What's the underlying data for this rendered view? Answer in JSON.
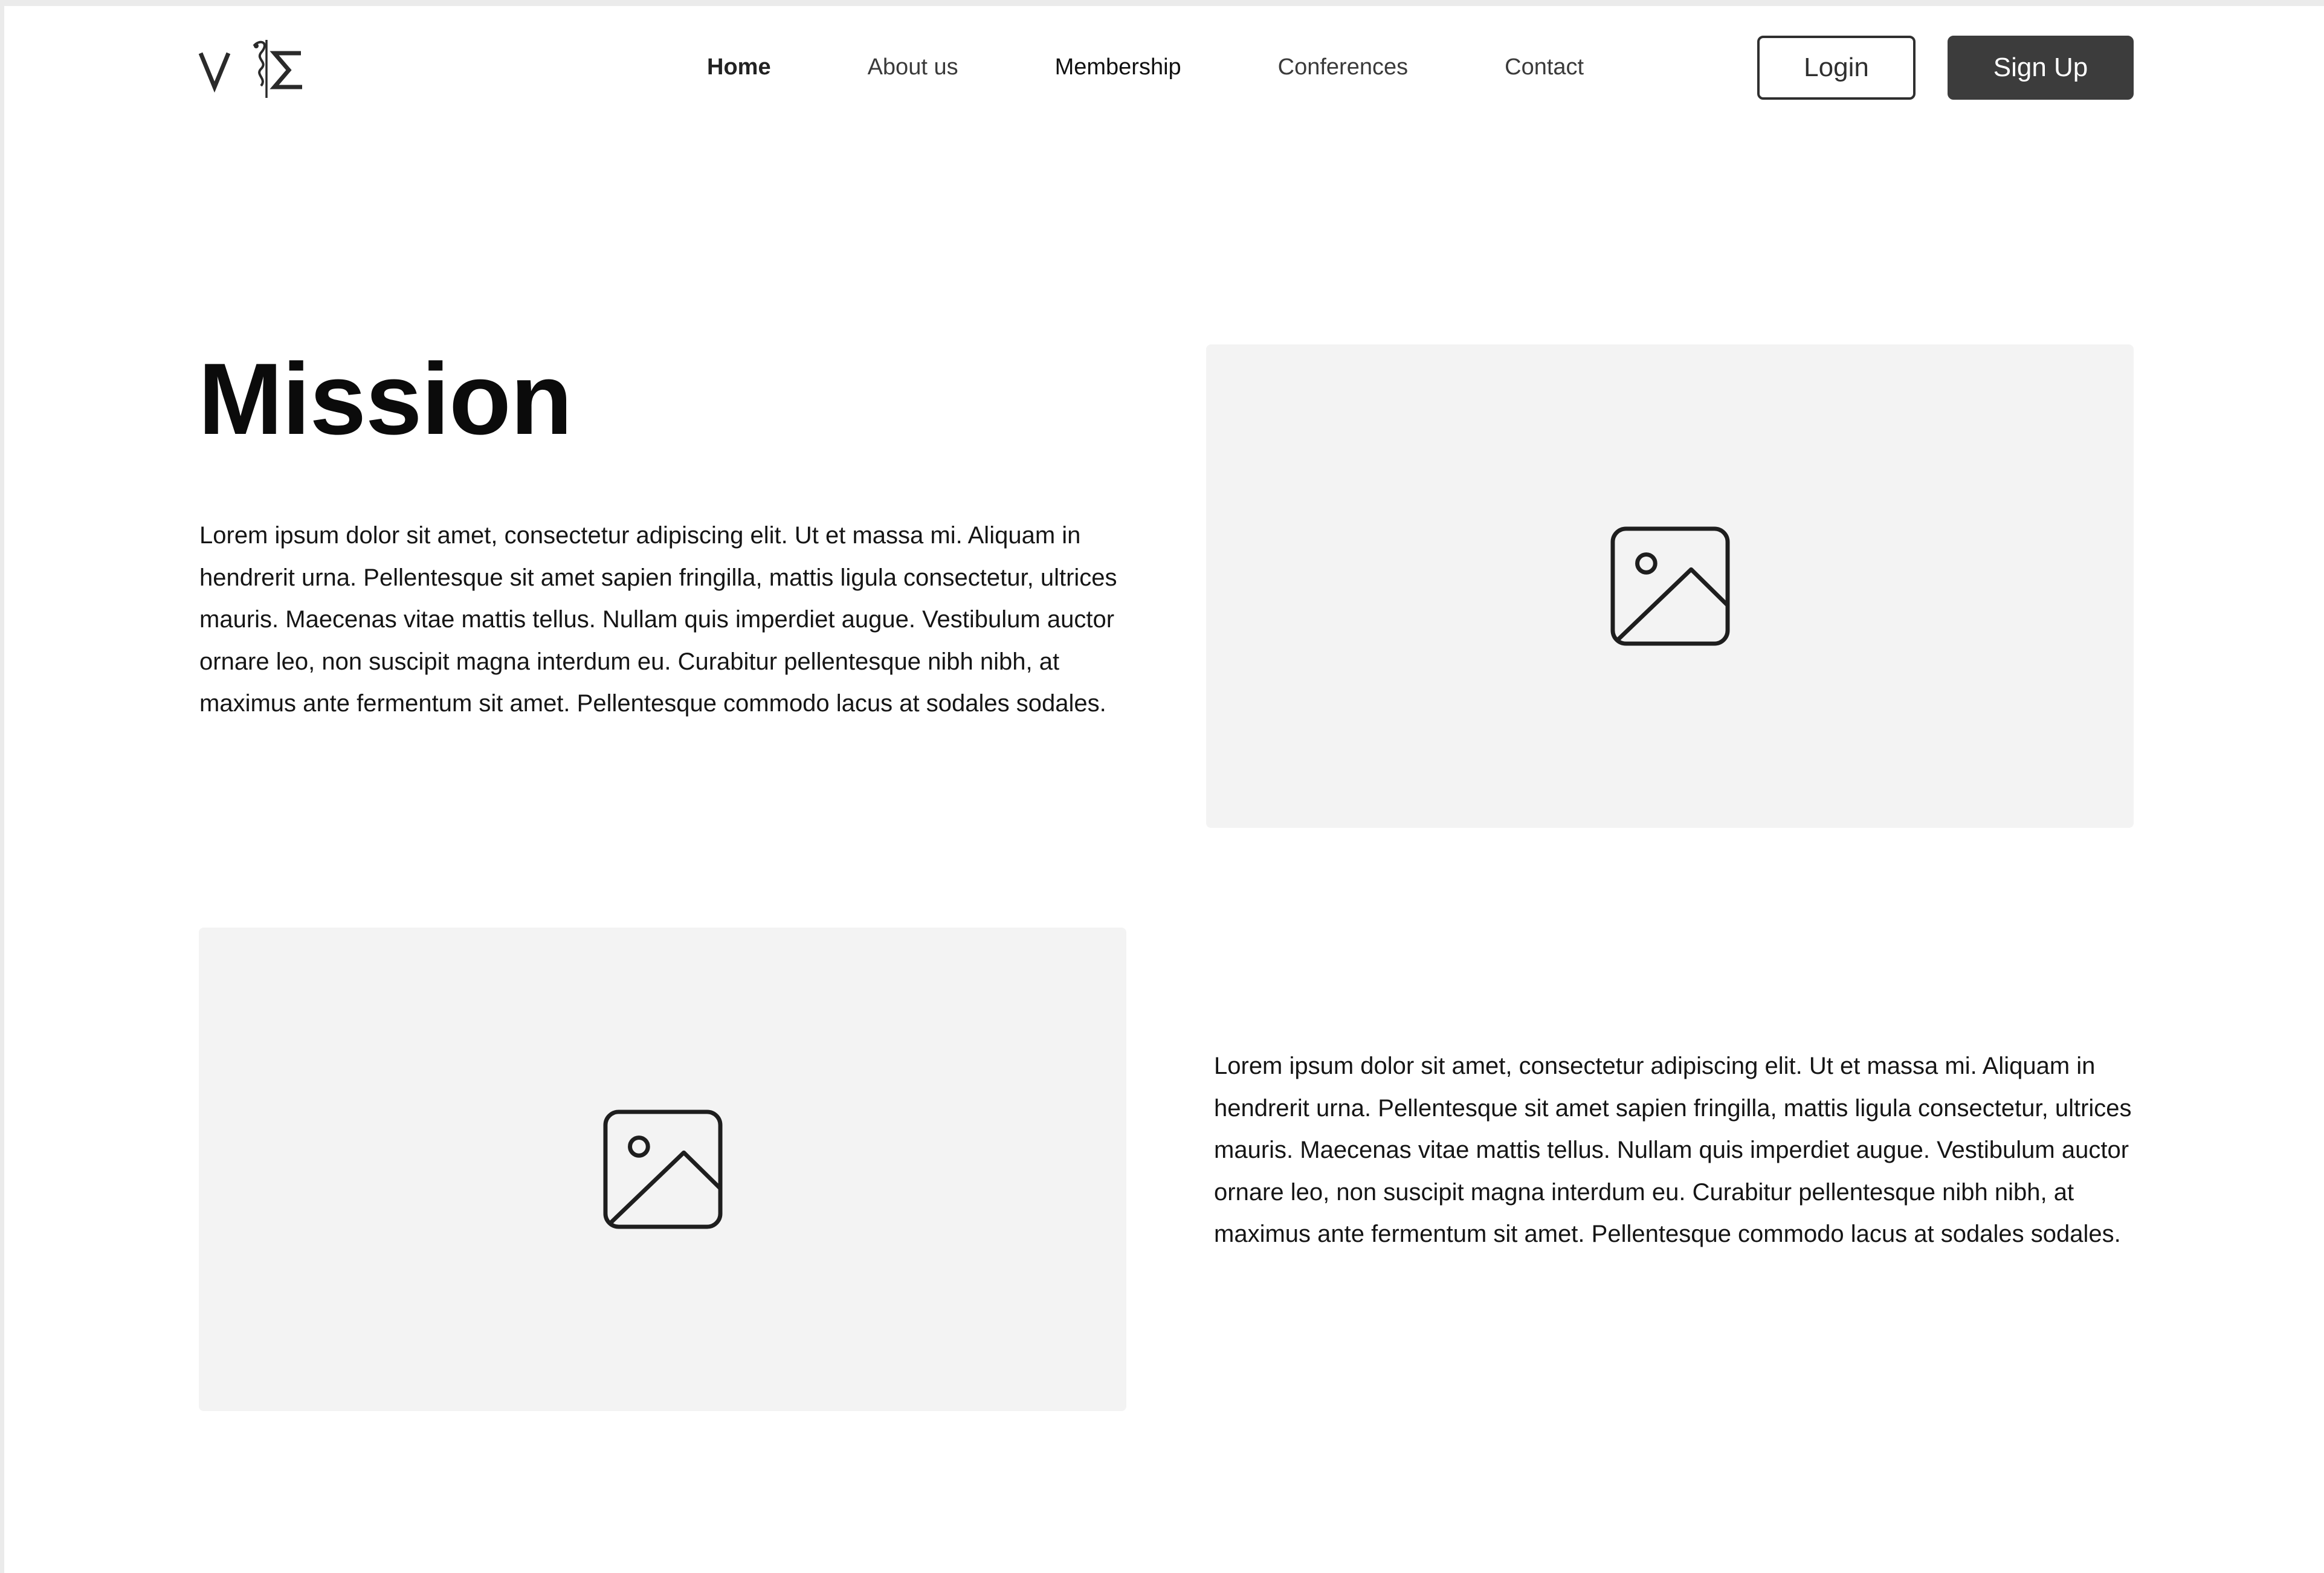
{
  "header": {
    "logo": {
      "name": "site-logo",
      "letters": "V⚕Σ"
    },
    "nav": [
      {
        "label": "Home",
        "active": true
      },
      {
        "label": "About us",
        "active": false
      },
      {
        "label": "Membership",
        "active": false
      },
      {
        "label": "Conferences",
        "active": false
      },
      {
        "label": "Contact",
        "active": false
      }
    ],
    "login_label": "Login",
    "signup_label": "Sign Up"
  },
  "mission": {
    "title": "Mission",
    "paragraph_1": "Lorem ipsum dolor sit amet, consectetur adipiscing elit. Ut et massa mi. Aliquam in hendrerit urna. Pellentesque sit amet sapien fringilla, mattis ligula consectetur, ultrices mauris. Maecenas vitae mattis tellus. Nullam quis imperdiet augue. Vestibulum auctor ornare leo, non suscipit magna interdum eu. Curabitur pellentesque nibh nibh, at maximus ante fermentum sit amet. Pellentesque commodo lacus at sodales sodales.",
    "paragraph_2": "Lorem ipsum dolor sit amet, consectetur adipiscing elit. Ut et massa mi. Aliquam in hendrerit urna. Pellentesque sit amet sapien fringilla, mattis ligula consectetur, ultrices mauris. Maecenas vitae mattis tellus. Nullam quis imperdiet augue. Vestibulum auctor ornare leo, non suscipit magna interdum eu. Curabitur pellentesque nibh nibh, at maximus ante fermentum sit amet. Pellentesque commodo lacus at sodales sodales.",
    "images": [
      {
        "icon": "image-placeholder-icon"
      },
      {
        "icon": "image-placeholder-icon"
      }
    ]
  },
  "colors": {
    "background": "#ffffff",
    "placeholder_fill": "#f3f3f3",
    "primary_button": "#3c3c3c",
    "text": "#111111"
  }
}
